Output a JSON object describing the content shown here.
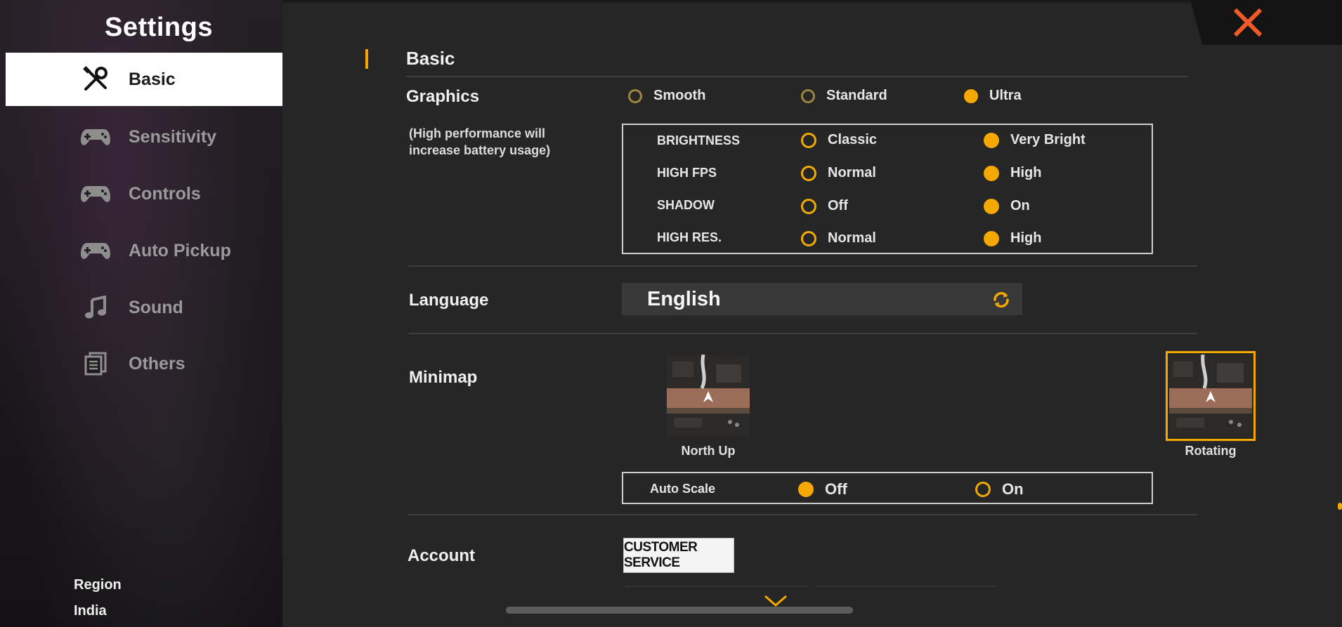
{
  "sidebar": {
    "title": "Settings",
    "items": [
      {
        "label": "Basic",
        "icon": "tools-icon",
        "active": true
      },
      {
        "label": "Sensitivity",
        "icon": "gamepad-icon"
      },
      {
        "label": "Controls",
        "icon": "gamepad-icon"
      },
      {
        "label": "Auto Pickup",
        "icon": "gamepad-icon"
      },
      {
        "label": "Sound",
        "icon": "music-note-icon"
      },
      {
        "label": "Others",
        "icon": "document-icon"
      }
    ],
    "region_label": "Region",
    "region_value": "India"
  },
  "main": {
    "section_title": "Basic",
    "graphics": {
      "label": "Graphics",
      "note_line1": "(High performance will",
      "note_line2": "increase battery usage)",
      "options": [
        {
          "label": "Smooth",
          "selected": false
        },
        {
          "label": "Standard",
          "selected": false
        },
        {
          "label": "Ultra",
          "selected": true
        }
      ],
      "settings": [
        {
          "name": "BRIGHTNESS",
          "option_a": "Classic",
          "option_b": "Very Bright",
          "selected": "b"
        },
        {
          "name": "HIGH FPS",
          "option_a": "Normal",
          "option_b": "High",
          "selected": "b"
        },
        {
          "name": "SHADOW",
          "option_a": "Off",
          "option_b": "On",
          "selected": "b"
        },
        {
          "name": "HIGH RES.",
          "option_a": "Normal",
          "option_b": "High",
          "selected": "b"
        }
      ]
    },
    "language": {
      "label": "Language",
      "value": "English"
    },
    "minimap": {
      "label": "Minimap",
      "options": [
        {
          "caption": "North Up",
          "selected": false
        },
        {
          "caption": "Rotating",
          "selected": true
        }
      ],
      "auto_scale": {
        "label": "Auto Scale",
        "option_a": "Off",
        "option_b": "On",
        "selected": "a"
      }
    },
    "account": {
      "label": "Account",
      "button": "CUSTOMER SERVICE"
    }
  },
  "colors": {
    "accent": "#f5a800",
    "close": "#f05a28"
  }
}
